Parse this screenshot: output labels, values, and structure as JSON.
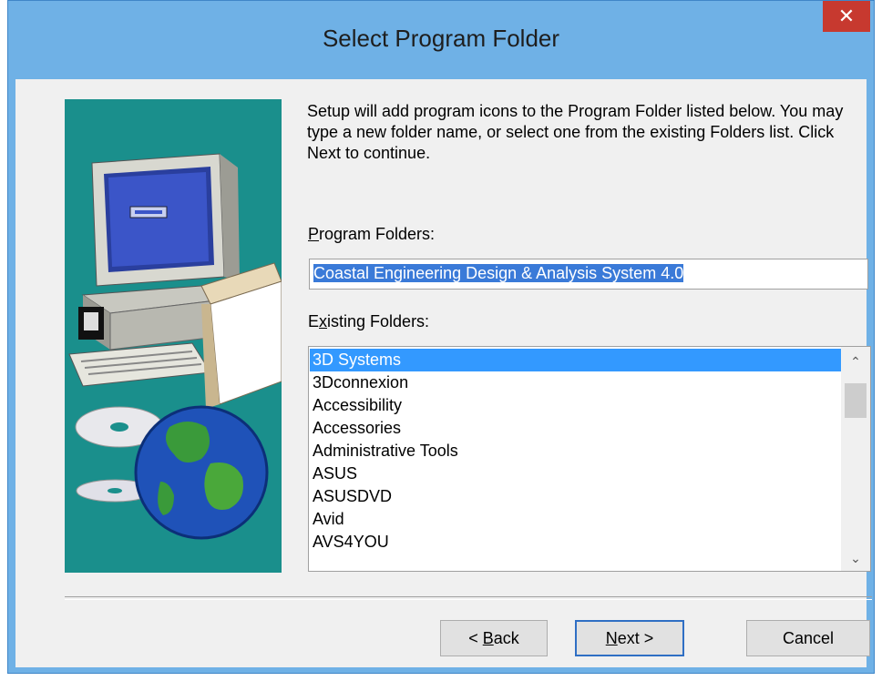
{
  "window": {
    "title": "Select Program Folder",
    "close_label": "✕"
  },
  "description": "Setup will add program icons to the Program Folder listed below. You may type a new folder name, or select one from the existing Folders list.  Click Next to continue.",
  "program_folders": {
    "label_mnemonic": "P",
    "label_rest": "rogram Folders:",
    "value": "Coastal Engineering Design & Analysis System 4.0"
  },
  "existing_folders": {
    "label_prefix": "E",
    "label_mnemonic": "x",
    "label_rest": "isting Folders:",
    "items": [
      "3D Systems",
      "3Dconnexion",
      "Accessibility",
      "Accessories",
      "Administrative Tools",
      "ASUS",
      "ASUSDVD",
      "Avid",
      "AVS4YOU"
    ],
    "selected_index": 0
  },
  "buttons": {
    "back_prefix": "< ",
    "back_mnemonic": "B",
    "back_rest": "ack",
    "next_mnemonic": "N",
    "next_rest": "ext >",
    "cancel": "Cancel"
  },
  "icons": {
    "close": "close-icon",
    "scroll_up": "chevron-up-icon",
    "scroll_down": "chevron-down-icon",
    "illustration": "computer-globe-illustration"
  },
  "colors": {
    "title_bar": "#6fb1e6",
    "close_button": "#c7392f",
    "art_background": "#1a8f8c",
    "selection": "#3399ff",
    "input_selection": "#3a7ad8"
  }
}
